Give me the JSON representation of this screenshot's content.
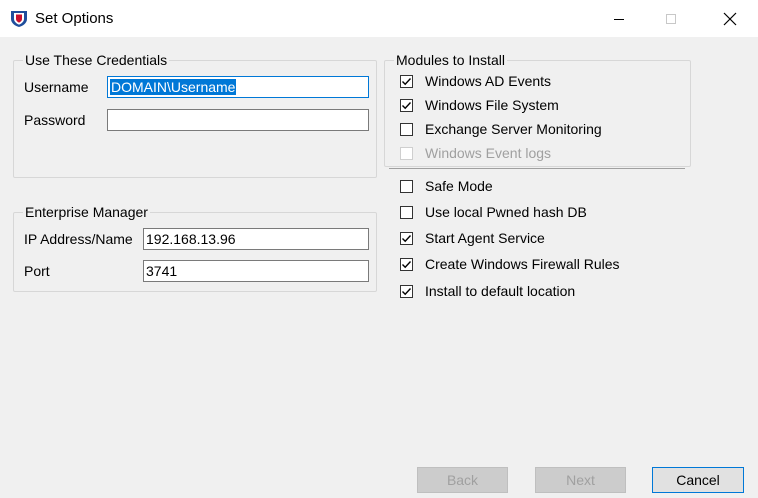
{
  "window": {
    "title": "Set Options"
  },
  "credentials": {
    "group_label": "Use These Credentials",
    "username_label": "Username",
    "username_value": "DOMAIN\\Username",
    "password_label": "Password",
    "password_value": ""
  },
  "enterprise": {
    "group_label": "Enterprise Manager",
    "ip_label": "IP Address/Name",
    "ip_value": "192.168.13.96",
    "port_label": "Port",
    "port_value": "3741"
  },
  "modules": {
    "group_label": "Modules to Install",
    "items": [
      {
        "label": "Windows AD Events",
        "checked": true,
        "enabled": true
      },
      {
        "label": "Windows File System",
        "checked": true,
        "enabled": true
      },
      {
        "label": "Exchange Server Monitoring",
        "checked": false,
        "enabled": true
      },
      {
        "label": "Windows Event logs",
        "checked": false,
        "enabled": false
      }
    ]
  },
  "options": [
    {
      "label": "Safe Mode",
      "checked": false
    },
    {
      "label": "Use local Pwned hash DB",
      "checked": false
    },
    {
      "label": "Start Agent Service",
      "checked": true
    },
    {
      "label": "Create Windows Firewall Rules",
      "checked": true
    },
    {
      "label": "Install to default location",
      "checked": true
    }
  ],
  "buttons": {
    "back": "Back",
    "next": "Next",
    "cancel": "Cancel"
  },
  "colors": {
    "accent": "#0078d7",
    "app_icon_red": "#c8102e",
    "app_icon_blue": "#1f4e9c"
  }
}
